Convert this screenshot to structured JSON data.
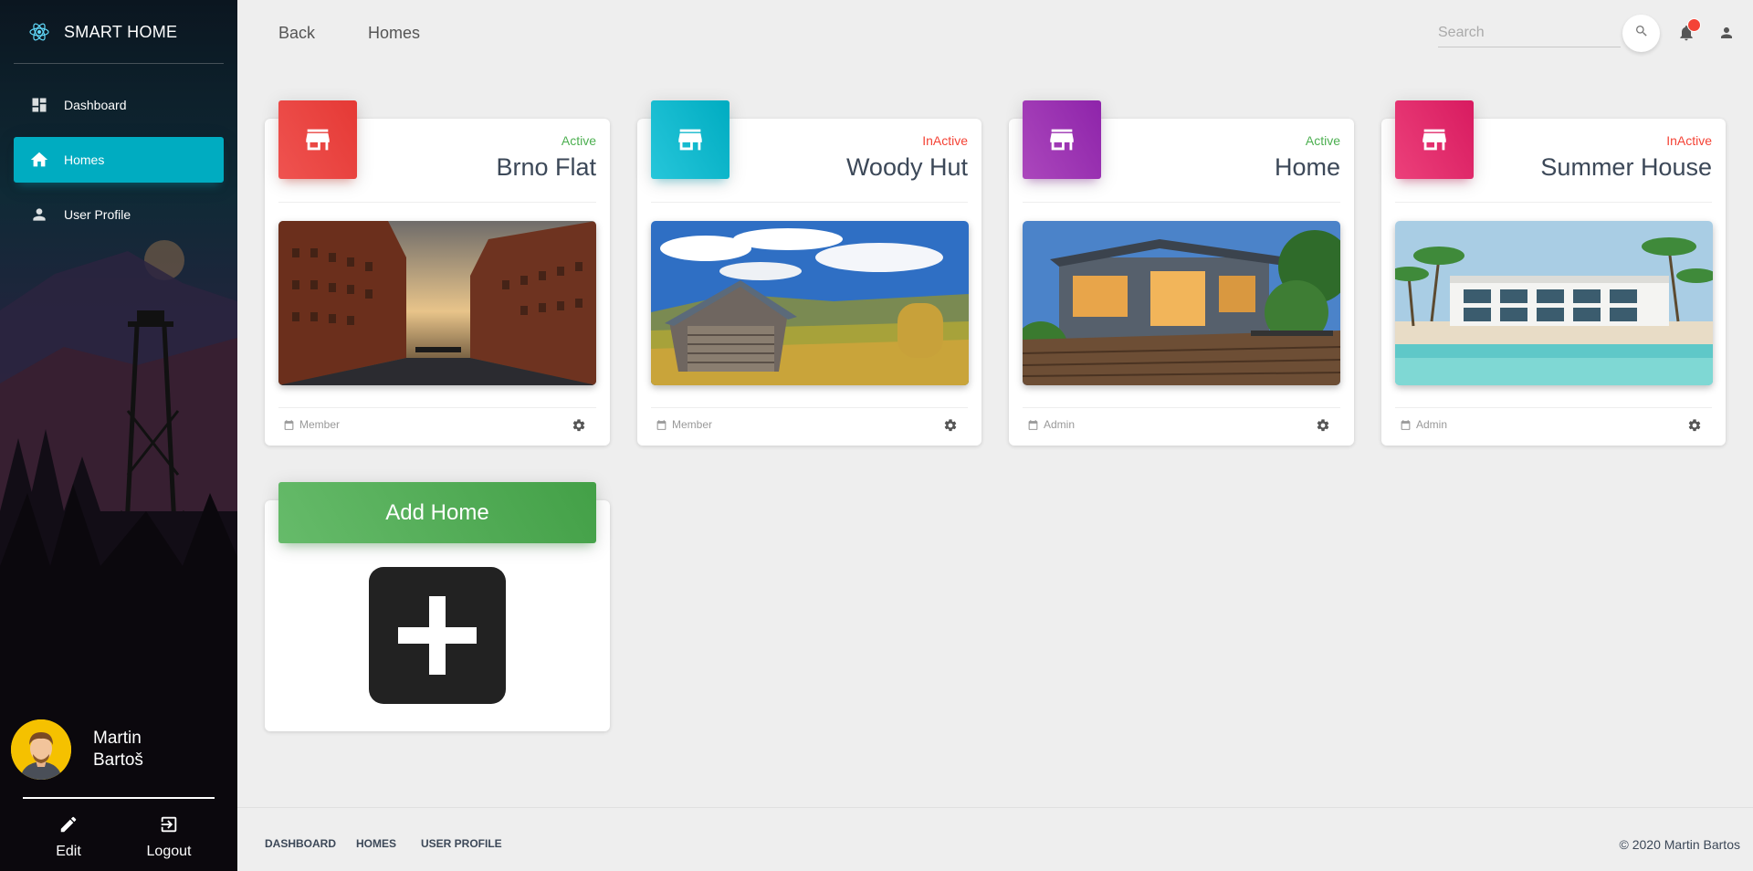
{
  "app": {
    "brand": "SMART HOME"
  },
  "sidebar": {
    "items": [
      {
        "label": "Dashboard",
        "icon": "dashboard-icon",
        "active": false
      },
      {
        "label": "Homes",
        "icon": "home-icon",
        "active": true
      },
      {
        "label": "User Profile",
        "icon": "person-icon",
        "active": false
      }
    ],
    "user": {
      "first_name": "Martin",
      "last_name": "Bartoš"
    },
    "actions": {
      "edit_label": "Edit",
      "logout_label": "Logout"
    }
  },
  "header": {
    "back_label": "Back",
    "crumb_label": "Homes",
    "search": {
      "placeholder": "Search",
      "value": ""
    }
  },
  "homes": [
    {
      "name": "Brno Flat",
      "status": "Active",
      "role": "Member",
      "icon_color": "#ef5350"
    },
    {
      "name": "Woody Hut",
      "status": "InActive",
      "role": "Member",
      "icon_color": "#26c6da"
    },
    {
      "name": "Home",
      "status": "Active",
      "role": "Admin",
      "icon_color": "#ab47bc"
    },
    {
      "name": "Summer House",
      "status": "InActive",
      "role": "Admin",
      "icon_color": "#ec407a"
    }
  ],
  "add_home": {
    "label": "Add Home"
  },
  "footer": {
    "links": [
      "DASHBOARD",
      "HOMES",
      "USER PROFILE"
    ],
    "copyright": "© 2020 Martin Bartos"
  },
  "colors": {
    "accent": "#00acc1",
    "active": "#4caf50",
    "inactive": "#f44336",
    "add_button": "#4caf50"
  }
}
